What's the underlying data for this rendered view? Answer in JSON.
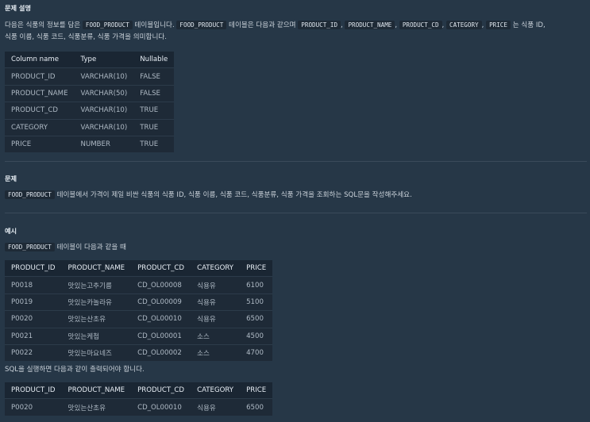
{
  "section_desc": {
    "title": "문제 설명",
    "line1_a": "다음은 식품의 정보를 담은",
    "code_table": "FOOD_PRODUCT",
    "line1_b": "테이블입니다.",
    "line1_c": "테이블은 다음과 같으며",
    "code_cols": [
      "PRODUCT_ID",
      "PRODUCT_NAME",
      "PRODUCT_CD",
      "CATEGORY",
      "PRICE"
    ],
    "sep": ",",
    "line1_d": "는 식품 ID,",
    "line2": "식품 이름, 식품 코드, 식품분류, 식품 가격을 의미합니다."
  },
  "schema_table": {
    "headers": [
      "Column name",
      "Type",
      "Nullable"
    ],
    "rows": [
      [
        "PRODUCT_ID",
        "VARCHAR(10)",
        "FALSE"
      ],
      [
        "PRODUCT_NAME",
        "VARCHAR(50)",
        "FALSE"
      ],
      [
        "PRODUCT_CD",
        "VARCHAR(10)",
        "TRUE"
      ],
      [
        "CATEGORY",
        "VARCHAR(10)",
        "TRUE"
      ],
      [
        "PRICE",
        "NUMBER",
        "TRUE"
      ]
    ]
  },
  "section_problem": {
    "title": "문제",
    "code_table": "FOOD_PRODUCT",
    "text": "테이블에서 가격이 제일 비싼 식품의 식품 ID, 식품 이름, 식품 코드, 식품분류, 식품 가격을 조회하는 SQL문을 작성해주세요."
  },
  "section_example": {
    "title": "예시",
    "code_table": "FOOD_PRODUCT",
    "intro": "테이블이 다음과 같을 때",
    "result_text": "SQL을 실행하면 다음과 같이 출력되어야 합니다."
  },
  "example_table": {
    "headers": [
      "PRODUCT_ID",
      "PRODUCT_NAME",
      "PRODUCT_CD",
      "CATEGORY",
      "PRICE"
    ],
    "rows": [
      [
        "P0018",
        "맛있는고추기름",
        "CD_OL00008",
        "식용유",
        "6100"
      ],
      [
        "P0019",
        "맛있는카놀라유",
        "CD_OL00009",
        "식용유",
        "5100"
      ],
      [
        "P0020",
        "맛있는산초유",
        "CD_OL00010",
        "식용유",
        "6500"
      ],
      [
        "P0021",
        "맛있는케첩",
        "CD_OL00001",
        "소스",
        "4500"
      ],
      [
        "P0022",
        "맛있는마요네즈",
        "CD_OL00002",
        "소스",
        "4700"
      ]
    ]
  },
  "result_table": {
    "headers": [
      "PRODUCT_ID",
      "PRODUCT_NAME",
      "PRODUCT_CD",
      "CATEGORY",
      "PRICE"
    ],
    "rows": [
      [
        "P0020",
        "맛있는산초유",
        "CD_OL00010",
        "식용유",
        "6500"
      ]
    ]
  }
}
